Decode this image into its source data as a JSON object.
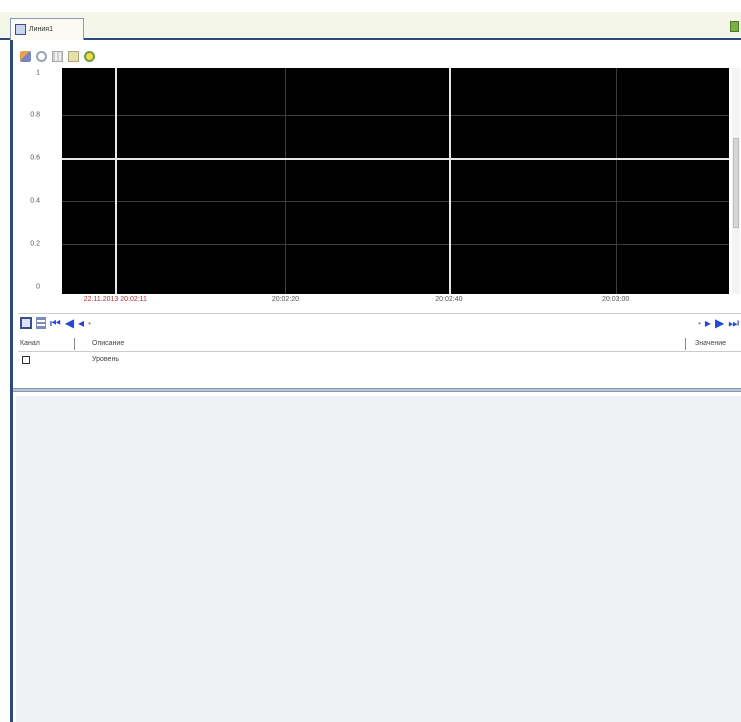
{
  "tab": {
    "label": "Линия1",
    "icon": "document-window-icon"
  },
  "plot_toolbar": {
    "icons": [
      "pencil-icon",
      "zoom-icon",
      "grid-icon",
      "fit-icon",
      "settings-icon"
    ]
  },
  "chart": {
    "background": "#000000",
    "cursor_color": "#e6e6e6",
    "y_ticks": [
      "1",
      "0.8",
      "0.6",
      "0.4",
      "0.2",
      "0"
    ],
    "x_ticks": [
      "22.11.2013 20:02:11",
      "20:02:20",
      "20:02:40",
      "20:03:00"
    ]
  },
  "chart_data": {
    "type": "line",
    "title": "",
    "xlabel": "",
    "ylabel": "",
    "ylim": [
      0,
      1
    ],
    "x_ticks": [
      "22.11.2013 20:02:11",
      "20:02:20",
      "20:02:40",
      "20:03:00"
    ],
    "series": [],
    "grid": true
  },
  "nav_toolbar": {
    "left_icons": [
      "save-icon",
      "table-icon",
      "first-icon",
      "prev-page-icon",
      "prev-icon"
    ],
    "right_icons": [
      "next-icon",
      "next-page-icon",
      "last-icon"
    ]
  },
  "table": {
    "columns": [
      "Канал",
      "Описание",
      "Значение"
    ],
    "rows": [
      {
        "description": "Уровень"
      }
    ]
  }
}
